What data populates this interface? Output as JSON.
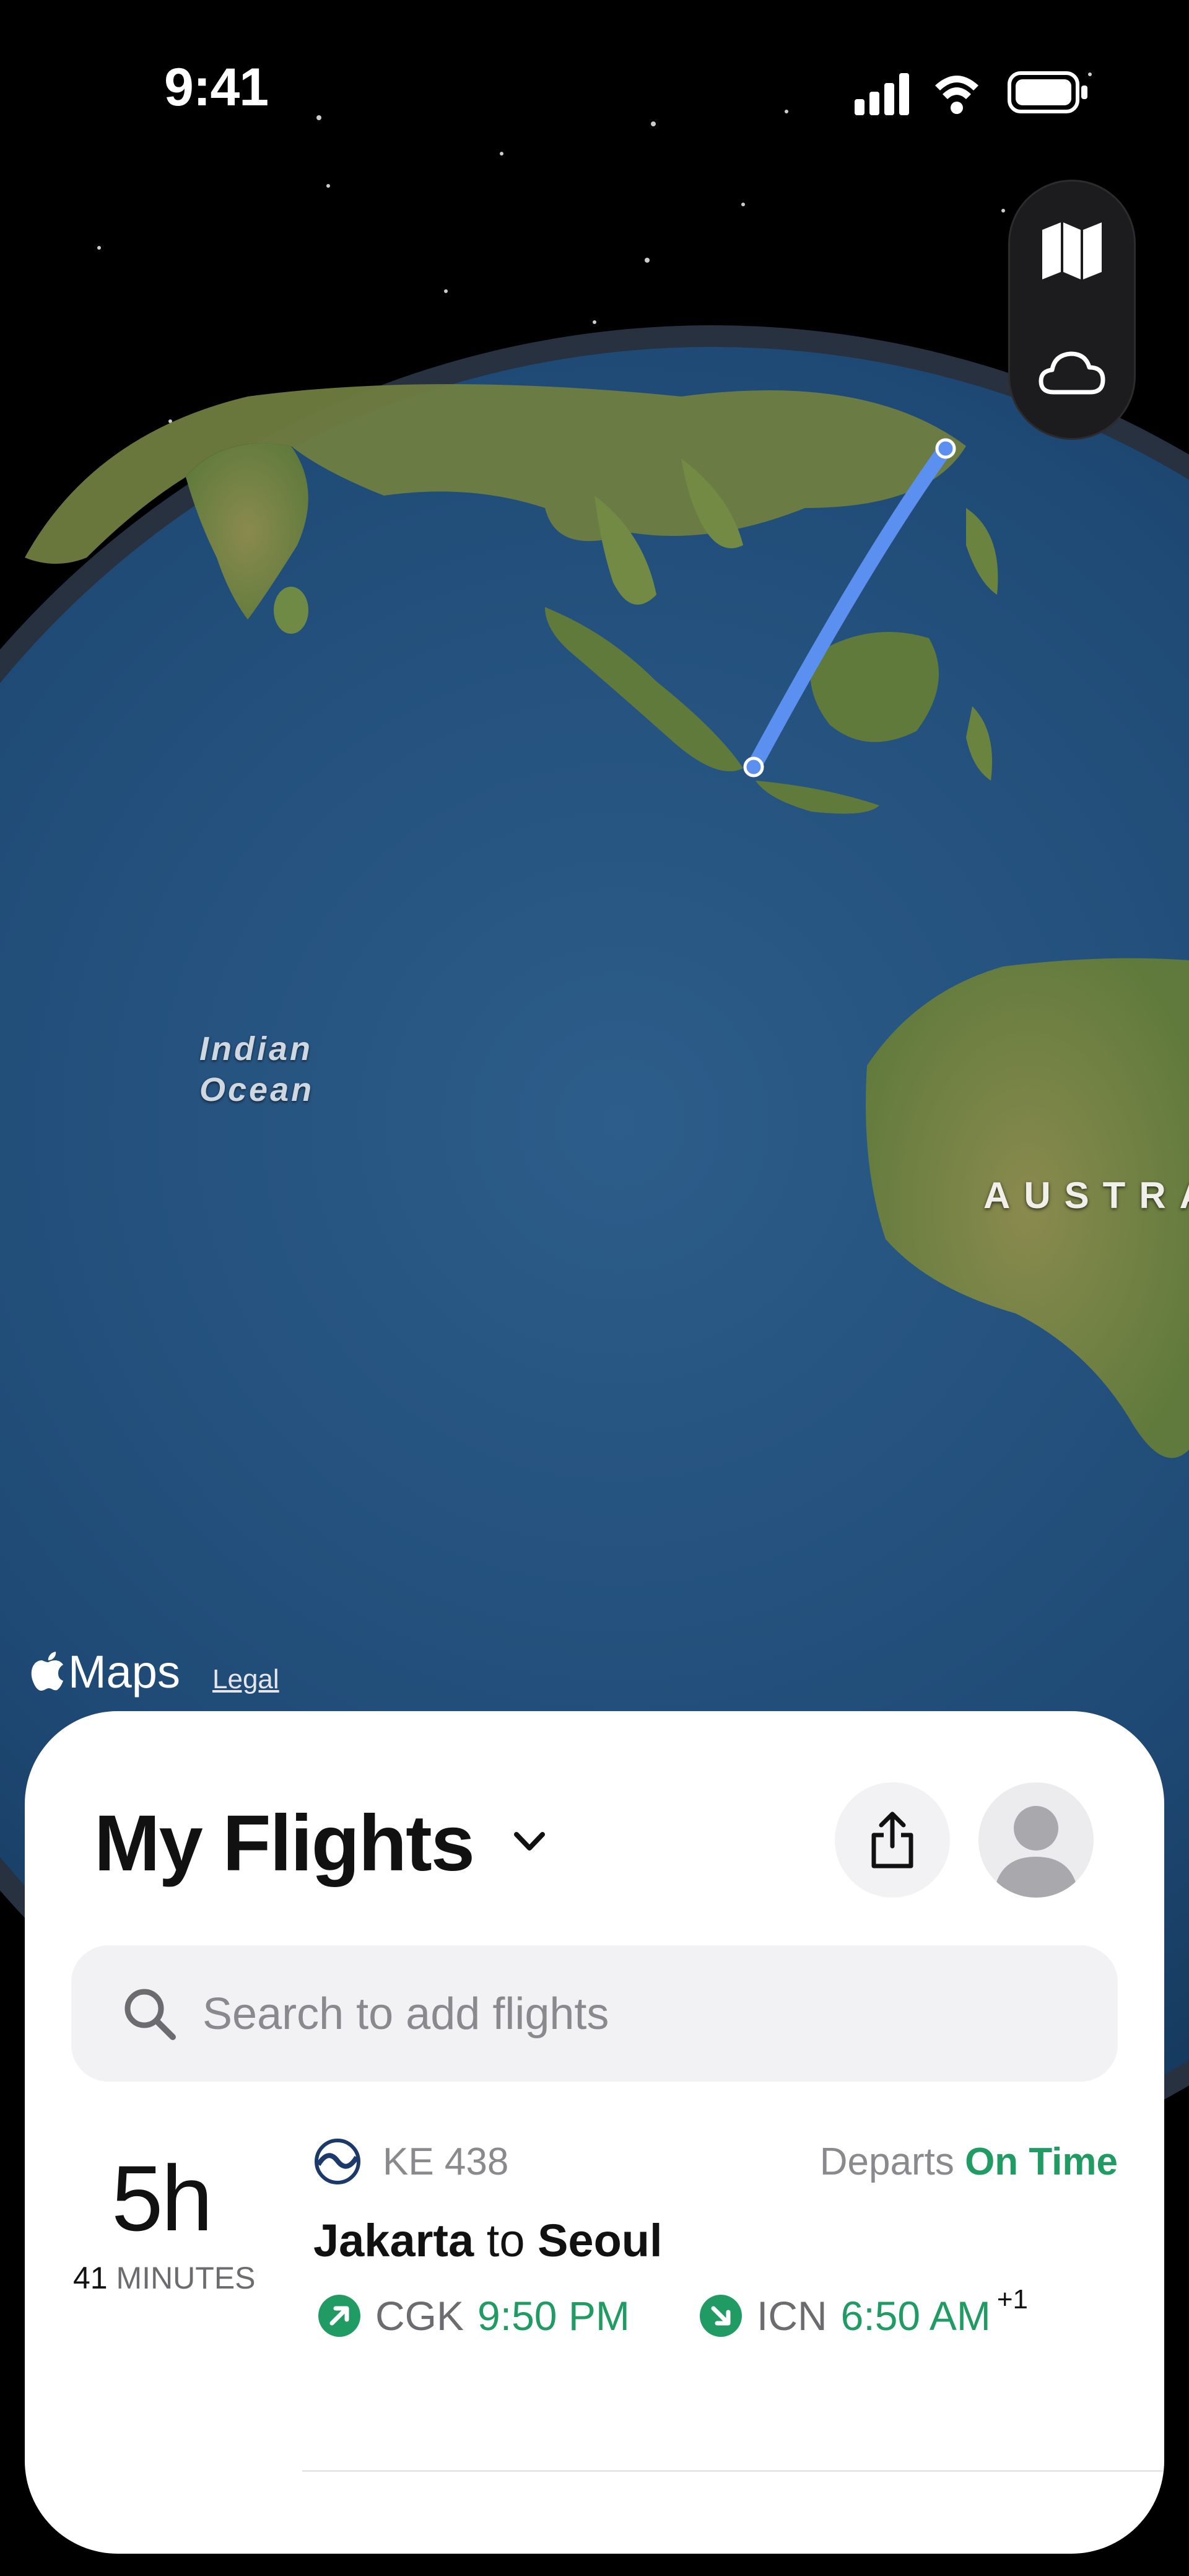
{
  "status_bar": {
    "time": "9:41"
  },
  "map_controls": {
    "map_icon": "map-icon",
    "weather_icon": "cloud-icon"
  },
  "map": {
    "ocean_label": "Indian Ocean",
    "continent_label": "AUSTRA",
    "attribution": "Maps",
    "legal": "Legal"
  },
  "sheet": {
    "title": "My Flights",
    "search_placeholder": "Search to add flights",
    "flight": {
      "duration_hours": "5h",
      "duration_minutes": "41",
      "duration_minutes_unit": "MINUTES",
      "flight_number": "KE 438",
      "status_prefix": "Departs",
      "status": "On Time",
      "origin_city": "Jakarta",
      "route_connector": "to",
      "destination_city": "Seoul",
      "origin_code": "CGK",
      "departure_time": "9:50 PM",
      "destination_code": "ICN",
      "arrival_time": "6:50 AM",
      "day_offset": "+1"
    }
  },
  "colors": {
    "status_green": "#1f9b63",
    "route_blue": "#5b8ff0",
    "ocean": "#24507b",
    "land": "#7b8a44"
  }
}
